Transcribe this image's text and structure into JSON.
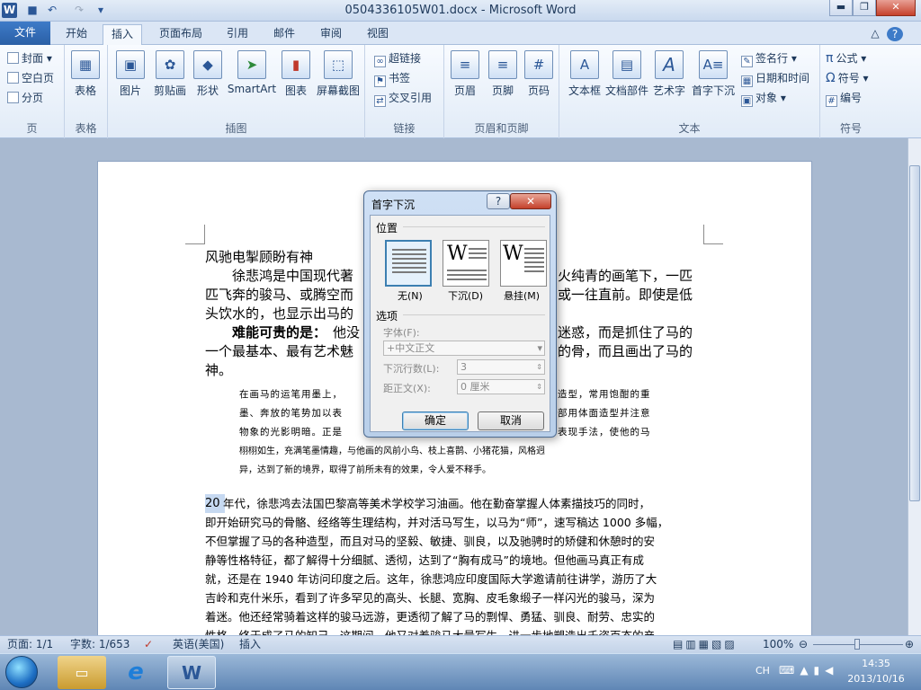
{
  "window": {
    "title": "0504336105W01.docx - Microsoft Word",
    "word_glyph": "W",
    "min_glyph": "▬",
    "max_glyph": "❐",
    "close_glyph": "✕"
  },
  "quick_access": {
    "undo_glyph": "↶",
    "redo_glyph": "↷",
    "customize_glyph": "▾",
    "save_glyph": "■"
  },
  "tabs": {
    "file": "文件",
    "home": "开始",
    "insert": "插入",
    "layout": "页面布局",
    "references": "引用",
    "mailings": "邮件",
    "review": "审阅",
    "view": "视图",
    "help_glyph": "?",
    "expand_glyph": "△"
  },
  "ribbon": {
    "pages": {
      "cover": "封面",
      "blank": "空白页",
      "break": "分页",
      "group": "页"
    },
    "tables": {
      "table": "表格",
      "group": "表格"
    },
    "illustrations": {
      "picture": "图片",
      "clipart": "剪贴画",
      "shapes": "形状",
      "smartart": "SmartArt",
      "chart": "图表",
      "screenshot": "屏幕截图",
      "group": "插图"
    },
    "links": {
      "hyperlink": "超链接",
      "bookmark": "书签",
      "crossref": "交叉引用",
      "group": "链接"
    },
    "header_footer": {
      "header": "页眉",
      "footer": "页脚",
      "pagenum": "页码",
      "group": "页眉和页脚"
    },
    "text": {
      "textbox": "文本框",
      "quickparts": "文档部件",
      "wordart": "艺术字",
      "dropcap": "首字下沉",
      "signature": "签名行",
      "datetime": "日期和时间",
      "object": "对象",
      "group": "文本"
    },
    "symbols": {
      "equation": "公式",
      "symbol": "符号",
      "number": "编号",
      "group": "符号",
      "pi_glyph": "π",
      "omega_glyph": "Ω",
      "hash_glyph": "#"
    }
  },
  "document": {
    "line1": "风驰电掣顾盼有神",
    "p1a": "徐悲鸿是中国现代著",
    "p1b": "火纯青的画笔下，一匹",
    "p1c": "匹飞奔的骏马、或腾空而",
    "p1d": "或一往直前。即使是低",
    "p1e": "头饮水的，也显示出马的",
    "p2a": "难能可贵的是：",
    "p2b": "他没",
    "p2c": "迷惑，而是抓住了马的",
    "p2d": "一个最基本、最有艺术魅",
    "p2e": "的骨，而且画出了马的",
    "p2f": "神。",
    "q1": "在画马的运笔用墨上，",
    "q1b": "造型，常用饱酣的重",
    "q2": "墨、奔放的笔势加以表",
    "q2b": "部用体面造型并注意",
    "q3": "物象的光影明暗。正是",
    "q3b": "表现手法，使他的马",
    "q4": "栩栩如生，充满笔墨情趣，与他画的风前小鸟、枝上喜鹊、小猪花猫，风格迥",
    "q5": "异，达到了新的境界，取得了前所未有的效果，令人爱不释手。",
    "p3": [
      "年代，徐悲鸿去法国巴黎高等美术学校学习油画。他在勤奋掌握人体素描技巧的同时，",
      "即开始研究马的骨骼、经络等生理结构，并对活马写生，以马为“师”，速写稿达 1000 多幅，",
      "不但掌握了马的各种造型，而且对马的坚毅、敏捷、驯良，以及驰骋时的矫健和休憩时的安",
      "静等性格特征，都了解得十分细腻、透彻，达到了“胸有成马”的境地。但他画马真正有成",
      "就，还是在 1940 年访问印度之后。这年，徐悲鸿应印度国际大学邀请前往讲学，游历了大",
      "吉岭和克什米乐，看到了许多罕见的高头、长腿、宽胸、皮毛象缎子一样闪光的骏马，深为",
      "着迷。他还经常骑着这样的骏马远游，更透彻了解了马的剽悍、勇猛、驯良、耐劳、忠实的",
      "性格，终于成了马的知己。这期间，他又对着骏马大量写生，进一步地塑造出千姿百态的产"
    ],
    "p3_start": "20"
  },
  "dialog": {
    "title": "首字下沉",
    "help": "?",
    "close": "✕",
    "position_label": "位置",
    "opt_none": "无(N)",
    "opt_dropped": "下沉(D)",
    "opt_margin": "悬挂(M)",
    "options_label": "选项",
    "font_label": "字体(F):",
    "font_value": "+中文正文",
    "lines_label": "下沉行数(L):",
    "lines_value": "3",
    "distance_label": "距正文(X):",
    "distance_value": "0 厘米",
    "ok": "确定",
    "cancel": "取消",
    "w_glyph": "W"
  },
  "statusbar": {
    "page": "页面: 1/1",
    "words": "字数: 1/653",
    "language": "英语(美国)",
    "mode": "插入",
    "zoom": "100%",
    "minus": "⊖",
    "plus": "⊕"
  },
  "taskbar": {
    "ime": "CH",
    "time": "14:35",
    "date": "2013/10/16",
    "ie_glyph": "e",
    "word_glyph": "W"
  }
}
